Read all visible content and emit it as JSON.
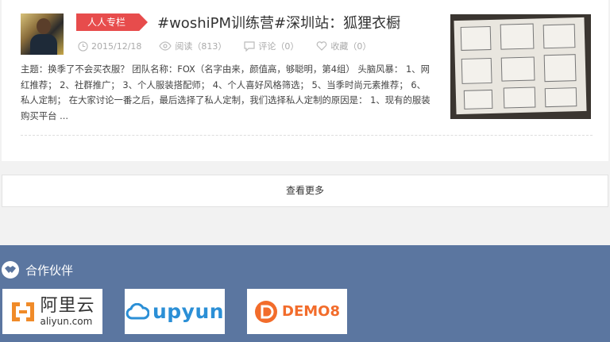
{
  "article": {
    "tag": "人人专栏",
    "title": "#woshiPM训练营#深圳站：狐狸衣橱",
    "date": "2015/12/18",
    "reads": "阅读（813）",
    "comments": "评论（0）",
    "favorites": "收藏（0）",
    "summary": "主题：换季了不会买衣服？ 团队名称：FOX（名字由来，颜值高，够聪明，第4组） 头脑风暴： 1、网红推荐； 2、社群推广； 3、个人服装搭配师； 4、个人喜好风格筛选； 5、当季时尚元素推荐； 6、私人定制； 在大家讨论一番之后，最后选择了私人定制，我们选择私人定制的原因是： 1、现有的服装购买平台 ..."
  },
  "load_more": "查看更多",
  "partners": {
    "heading": "合作伙伴",
    "aliyun_cn": "阿里云",
    "aliyun_en": "aliyun.com",
    "upyun": "upyun",
    "demo8": "DEMO8"
  },
  "colors": {
    "tag": "#e74c4c",
    "partners_bg": "#5b76a0",
    "upyun": "#2b8fd6",
    "demo8": "#f26c2b",
    "aliyun": "#f08b29"
  }
}
